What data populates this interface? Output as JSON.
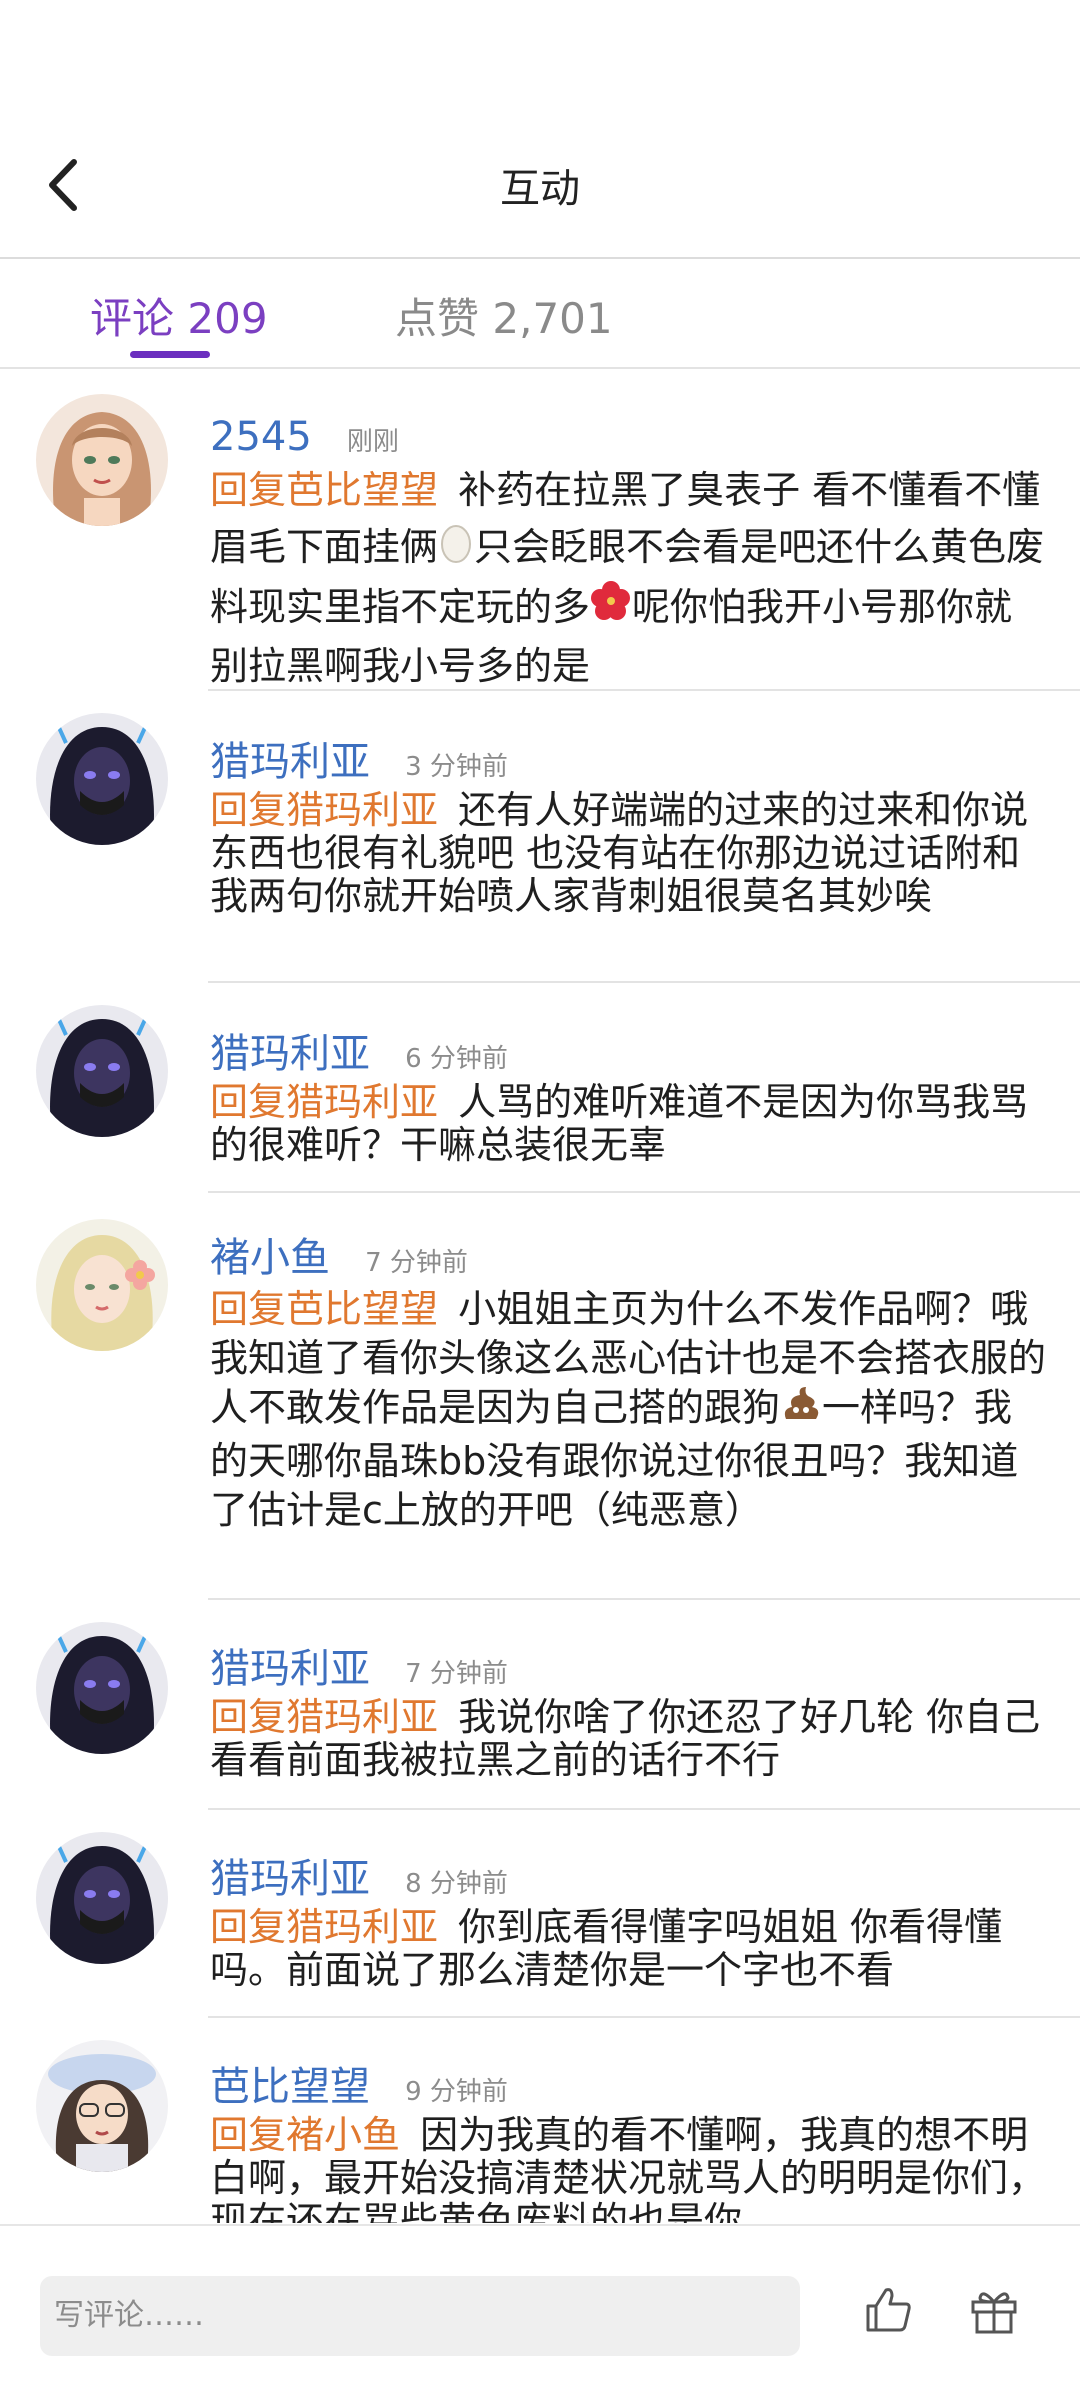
{
  "header": {
    "title": "互动"
  },
  "tabs": {
    "comments_label": "评论",
    "comments_count": "209",
    "likes_label": "点赞",
    "likes_count": "2,701"
  },
  "comments": [
    {
      "user": "2545",
      "time": "刚刚",
      "reply_to": "回复芭比望望",
      "text_a": " 补药在拉黑了臭表子 看不懂看不懂眉毛下面挂俩",
      "emoji_1": "egg-emoji",
      "text_b": "只会眨眼不会看是吧还什么黄色废料现实里指不定玩的多",
      "emoji_2": "hibiscus-emoji",
      "text_c": "呢你怕我开小号那你就别拉黑啊我小号多的是"
    },
    {
      "user": "猎玛利亚",
      "time": "3 分钟前",
      "reply_to": "回复猎玛利亚",
      "text": " 还有人好端端的过来的过来和你说东西也很有礼貌吧 也没有站在你那边说过话附和我两句你就开始喷人家背刺姐很莫名其妙唉"
    },
    {
      "user": "猎玛利亚",
      "time": "6 分钟前",
      "reply_to": "回复猎玛利亚",
      "text": " 人骂的难听难道不是因为你骂我骂的很难听？干嘛总装很无辜"
    },
    {
      "user": "褚小鱼",
      "time": "7 分钟前",
      "reply_to": "回复芭比望望",
      "text_a": " 小姐姐主页为什么不发作品啊？哦我知道了看你头像这么恶心估计也是不会搭衣服的人不敢发作品是因为自己搭的跟狗",
      "emoji_1": "poop-emoji",
      "text_b": "一样吗？我的天哪你晶珠bb没有跟你说过你很丑吗？我知道了估计是c上放的开吧（纯恶意）"
    },
    {
      "user": "猎玛利亚",
      "time": "7 分钟前",
      "reply_to": "回复猎玛利亚",
      "text": " 我说你啥了你还忍了好几轮 你自己看看前面我被拉黑之前的话行不行"
    },
    {
      "user": "猎玛利亚",
      "time": "8 分钟前",
      "reply_to": "回复猎玛利亚",
      "text": " 你到底看得懂字吗姐姐 你看得懂吗。前面说了那么清楚你是一个字也不看"
    },
    {
      "user": "芭比望望",
      "time": "9 分钟前",
      "reply_to": "回复褚小鱼",
      "text": " 因为我真的看不懂啊，我真的想不明白啊，最开始没搞清楚状况就骂人的明明是你们，现在还在骂些黄色废料的也是你"
    }
  ],
  "composer": {
    "placeholder": "写评论……"
  },
  "icons": {
    "back": "back-arrow-icon",
    "like": "thumbs-up-icon",
    "gift": "gift-icon"
  },
  "colors": {
    "accent": "#7b3fc1",
    "username": "#3d6fbf",
    "reply": "#e0782f"
  }
}
